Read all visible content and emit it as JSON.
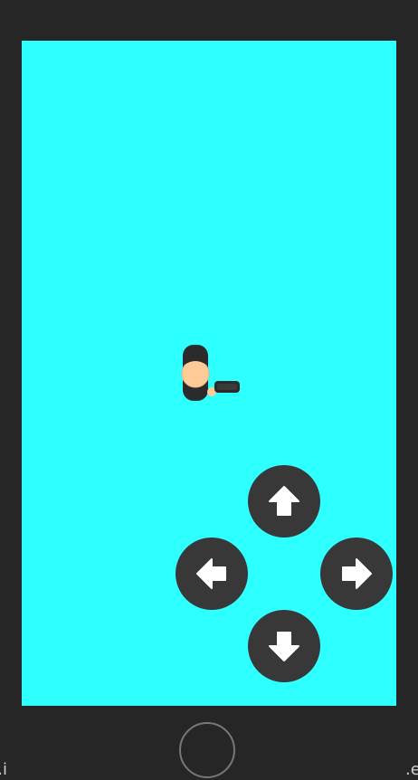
{
  "game": {
    "background_color": "#2effff",
    "device_color": "#262626"
  },
  "player": {
    "icon": "player-character-icon",
    "facing": "right",
    "hair_color": "#2b2b2b",
    "skin_color": "#ffcc99",
    "gun_color": "#3a3a3a"
  },
  "controls": {
    "up": {
      "icon": "arrow-up-icon"
    },
    "left": {
      "icon": "arrow-left-icon"
    },
    "right": {
      "icon": "arrow-right-icon"
    },
    "down": {
      "icon": "arrow-down-icon"
    },
    "button_color": "#383838",
    "arrow_color": "#ffffff"
  },
  "device": {
    "home_button_icon": "home-button-icon"
  },
  "edge_text": {
    "left": "i.",
    "right": ".e"
  }
}
